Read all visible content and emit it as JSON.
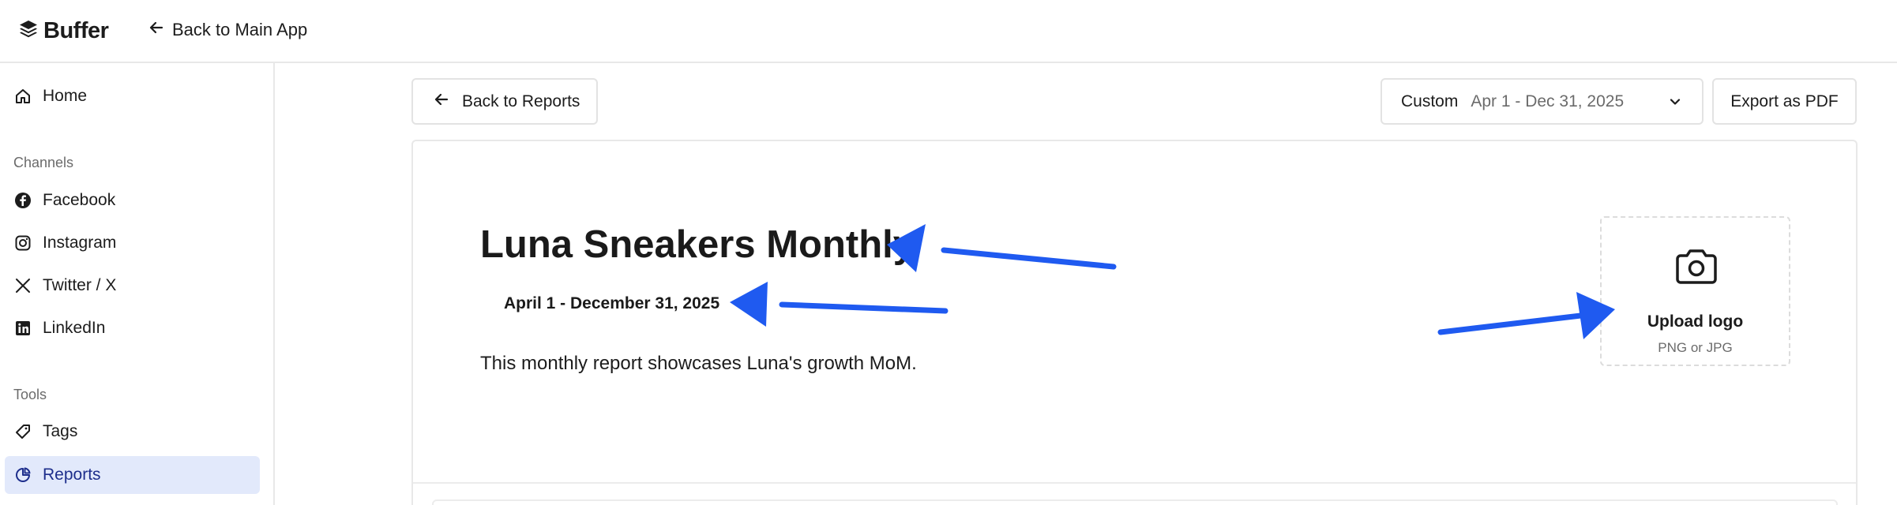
{
  "header": {
    "brand": "Buffer",
    "back_link": "Back to Main App"
  },
  "sidebar": {
    "home": "Home",
    "channels_label": "Channels",
    "channels": [
      "Facebook",
      "Instagram",
      "Twitter / X",
      "LinkedIn"
    ],
    "tools_label": "Tools",
    "tools": [
      "Tags",
      "Reports"
    ],
    "active_item": "Reports"
  },
  "toolbar": {
    "back_reports": "Back to Reports",
    "range_type": "Custom",
    "range_value": "Apr 1 - Dec 31, 2025",
    "export": "Export as PDF"
  },
  "report": {
    "title": "Luna Sneakers Monthly",
    "dates": "April 1 - December 31, 2025",
    "description": "This monthly report showcases Luna's growth MoM.",
    "upload_label": "Upload logo",
    "upload_hint": "PNG or JPG"
  },
  "colors": {
    "accent_arrow": "#1f5af0",
    "active_bg": "#e2e9fb",
    "active_text": "#1d2e8c"
  },
  "icons": [
    "buffer-logo-icon",
    "arrow-left-icon",
    "home-icon",
    "facebook-icon",
    "instagram-icon",
    "x-icon",
    "linkedin-icon",
    "tag-icon",
    "reports-icon",
    "chevron-down-icon",
    "camera-icon"
  ]
}
